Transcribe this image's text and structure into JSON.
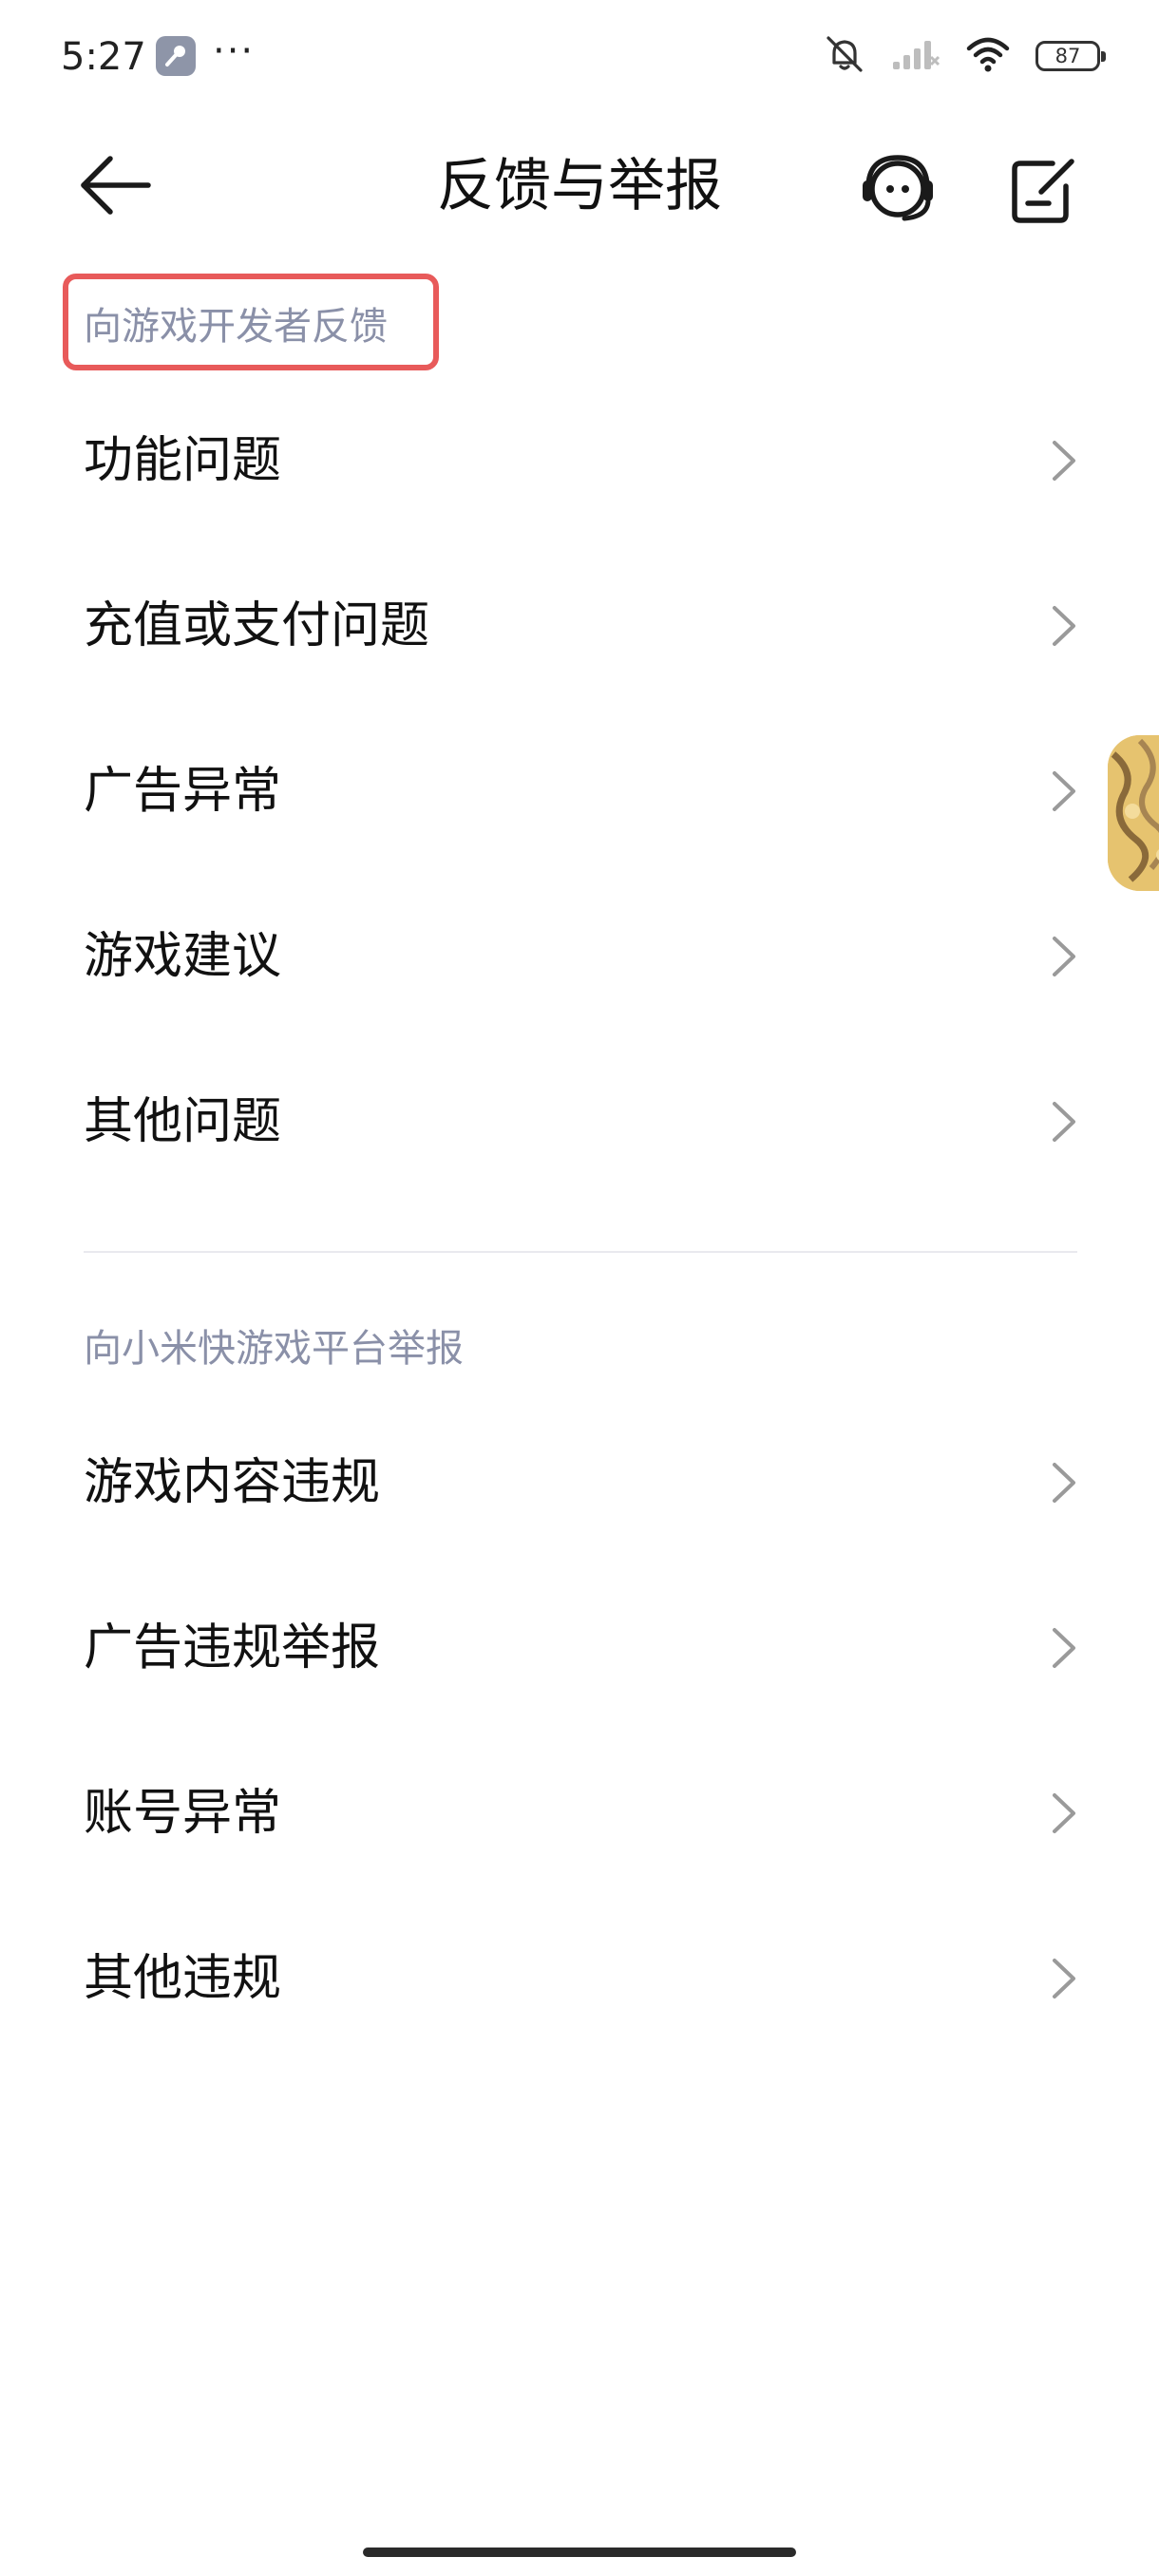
{
  "status_bar": {
    "time": "5:27",
    "more": "···",
    "battery": "87",
    "icons": [
      "key-app-icon",
      "mute-icon",
      "signal-icon",
      "wifi-icon",
      "battery-icon"
    ]
  },
  "header": {
    "title": "反馈与举报",
    "icons": [
      "back-arrow-icon",
      "customer-service-icon",
      "edit-icon"
    ]
  },
  "section_developer": {
    "title": "向游戏开发者反馈",
    "highlight_color": "#e85a5a",
    "items": [
      {
        "label": "功能问题"
      },
      {
        "label": "充值或支付问题"
      },
      {
        "label": "广告异常"
      },
      {
        "label": "游戏建议"
      },
      {
        "label": "其他问题"
      }
    ]
  },
  "section_platform": {
    "title": "向小米快游戏平台举报",
    "items": [
      {
        "label": "游戏内容违规"
      },
      {
        "label": "广告违规举报"
      },
      {
        "label": "账号异常"
      },
      {
        "label": "其他违规"
      }
    ]
  },
  "colors": {
    "section_title": "#8a90a8",
    "text": "#111111",
    "chevron": "#9a9a9a",
    "divider": "#e9e9ee"
  }
}
